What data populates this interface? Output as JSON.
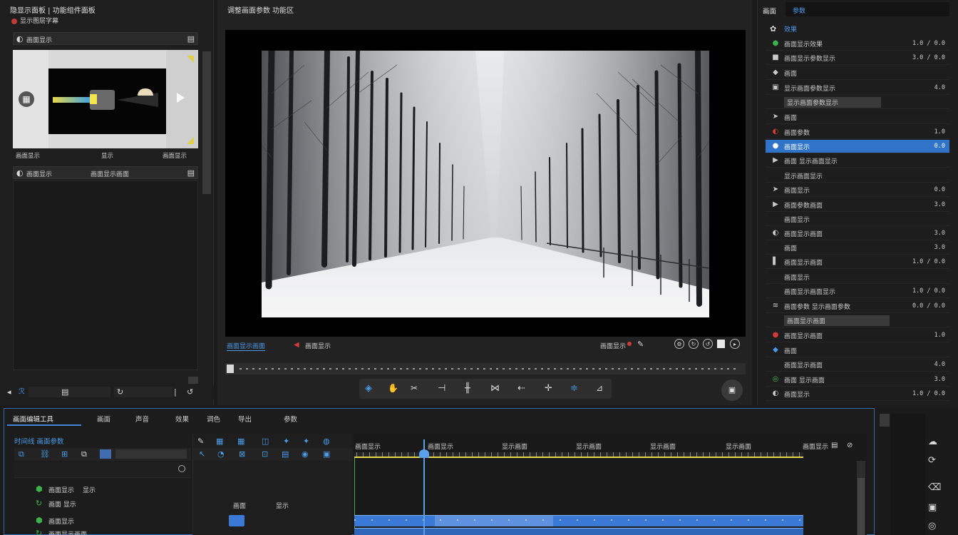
{
  "left_panel": {
    "header_line1": "隐显示面板 | 功能组件面板",
    "header_line2": "显示图层字幕",
    "section1_title": "画面显示",
    "thumb_caption_left": "画面显示",
    "thumb_caption_mid": "显示",
    "thumb_caption_right": "画面显示",
    "section2_title": "画面显示",
    "section2_mid": "画面显示画面"
  },
  "viewer": {
    "title": "调整画面参数 功能区",
    "bottom_left_label": "画面显示画面",
    "bottom_mid_label": "画面显示",
    "bottom_right_label": "画面显示",
    "transport_icons": [
      "select-tool-icon",
      "hand-tool-icon",
      "razor-tool-icon",
      "marker-icon",
      "split-icon",
      "trim-icon",
      "arrow-left-icon",
      "plus-icon",
      "align-icon",
      "crop-icon"
    ],
    "image_description_alt": ""
  },
  "inspector": {
    "tab1": "画面",
    "tab2": "参数",
    "section_title": "效果",
    "rows": [
      {
        "icon": "●",
        "label": "画面显示效果",
        "value": "1.0 / 0.0"
      },
      {
        "icon": "■",
        "label": "画面显示参数显示",
        "value": "3.0 / 0.0"
      },
      {
        "icon": "◆",
        "label": "画面",
        "value": ""
      },
      {
        "icon": "▣",
        "label": "显示画面参数显示",
        "value": "4.0"
      },
      {
        "icon": "",
        "label": "显示画面参数显示",
        "value": ""
      },
      {
        "icon": "➤",
        "label": "画面",
        "value": ""
      },
      {
        "icon": "◐",
        "label": "画面参数",
        "value": "1.0"
      },
      {
        "icon": "●",
        "label": "画面显示",
        "value": "0.0"
      },
      {
        "icon": "▶",
        "label": "画面 显示画面显示",
        "value": ""
      },
      {
        "icon": "",
        "label": "显示画面显示",
        "value": ""
      },
      {
        "icon": "➤",
        "label": "画面显示",
        "value": "0.0"
      },
      {
        "icon": "▶",
        "label": "画面参数画面",
        "value": "3.0"
      },
      {
        "icon": "",
        "label": "画面显示",
        "value": ""
      },
      {
        "icon": "◐",
        "label": "画面显示画面",
        "value": "3.0"
      },
      {
        "icon": "",
        "label": "画面",
        "value": "3.0"
      },
      {
        "icon": "▌",
        "label": "画面显示画面",
        "value": "1.0 / 0.0"
      },
      {
        "icon": "",
        "label": "画面显示",
        "value": ""
      },
      {
        "icon": "",
        "label": "画面显示画面显示",
        "value": "1.0 / 0.0"
      },
      {
        "icon": "≋",
        "label": "画面参数 显示画面参数",
        "value": "0.0 / 0.0"
      },
      {
        "icon": "",
        "label": "画面显示画面",
        "value": ""
      },
      {
        "icon": "●",
        "label": "画面显示画面",
        "value": "1.0"
      },
      {
        "icon": "◆",
        "label": "画面",
        "value": ""
      },
      {
        "icon": "",
        "label": "画面显示画面",
        "value": "4.0"
      },
      {
        "icon": "◎",
        "label": "画面 显示画面",
        "value": "3.0"
      },
      {
        "icon": "◐",
        "label": "画面显示",
        "value": "1.0 / 0.0"
      }
    ]
  },
  "timeline": {
    "tab_main": "画面编辑工具",
    "tabs": [
      "画面",
      "声音",
      "效果",
      "调色",
      "导出",
      "参数"
    ],
    "track_header_title": "时间线 画面参数",
    "ruler_labels": [
      "画面显示",
      "画面显示",
      "显示画面",
      "显示画面",
      "显示画面",
      "显示画面",
      "画面显示"
    ],
    "track_rows": [
      {
        "label": "画面显示",
        "extra": "显示"
      },
      {
        "label": "画面 显示",
        "extra": ""
      },
      {
        "label": "画面显示",
        "extra": ""
      },
      {
        "label": "画面显示画面",
        "extra": ""
      }
    ],
    "center_labels": [
      "画面",
      "显示"
    ],
    "accent": "#2f6fb0",
    "clip_color": "#3b79d6",
    "playhead_color": "#5aa0e8",
    "ruler_color": "#e6d64a"
  },
  "colors": {
    "background": "#1b1b1b",
    "panel": "#202020",
    "selected_row": "#2f74c8",
    "accent_blue": "#4a9be8"
  }
}
